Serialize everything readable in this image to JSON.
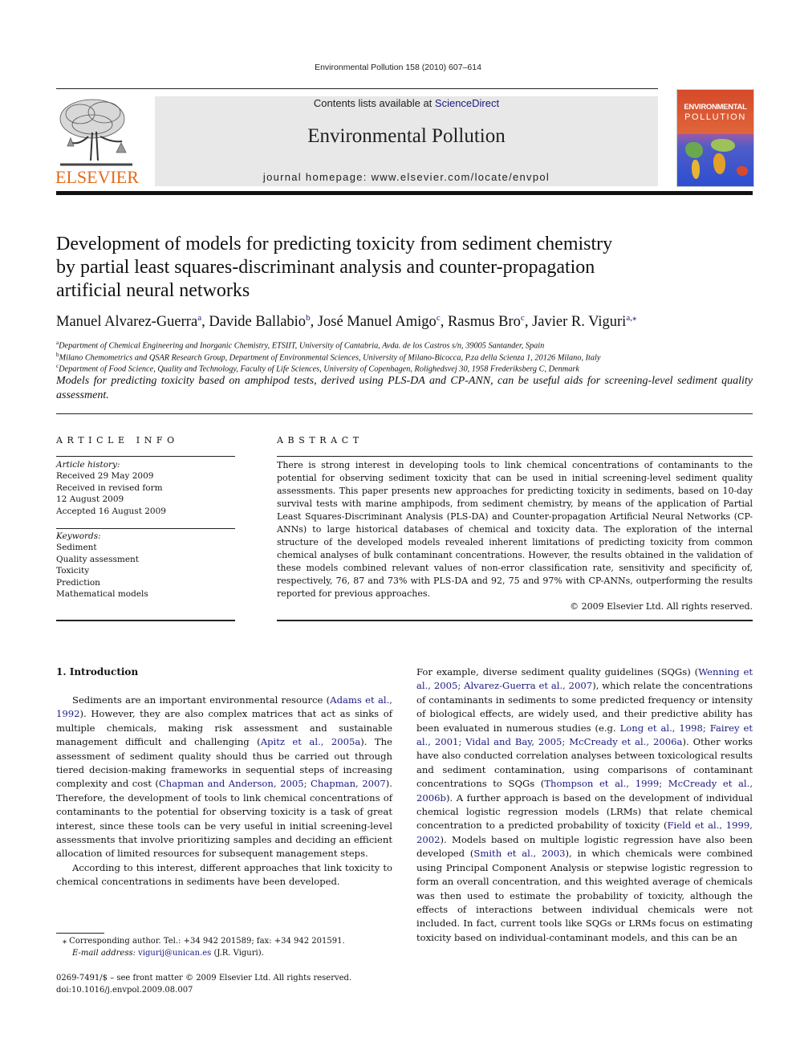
{
  "journal_citation": "Environmental Pollution 158 (2010) 607–614",
  "publisher": {
    "logo_text": "ELSEVIER",
    "logo_icon": "elsevier-tree-icon"
  },
  "banner": {
    "contents_prefix": "Contents lists available at ",
    "contents_link": "ScienceDirect",
    "journal_title": "Environmental Pollution",
    "homepage": "journal homepage: www.elsevier.com/locate/envpol"
  },
  "cover": {
    "line1": "ENVIRONMENTAL",
    "line2": "POLLUTION"
  },
  "article": {
    "title_lines": [
      "Development of models for predicting toxicity from sediment chemistry",
      "by partial least squares-discriminant analysis and counter-propagation",
      "artificial neural networks"
    ],
    "authors": [
      {
        "name": "Manuel Alvarez-Guerra",
        "aff": "a"
      },
      {
        "name": "Davide Ballabio",
        "aff": "b"
      },
      {
        "name": "José Manuel Amigo",
        "aff": "c"
      },
      {
        "name": "Rasmus Bro",
        "aff": "c"
      },
      {
        "name": "Javier R. Viguri",
        "aff": "a,⁎"
      }
    ],
    "affiliations": [
      {
        "key": "a",
        "text": "Department of Chemical Engineering and Inorganic Chemistry, ETSIIT, University of Cantabria, Avda. de los Castros s/n, 39005 Santander, Spain"
      },
      {
        "key": "b",
        "text": "Milano Chemometrics and QSAR Research Group, Department of Environmental Sciences, University of Milano-Bicocca, P.za della Scienza 1, 20126 Milano, Italy"
      },
      {
        "key": "c",
        "text": "Department of Food Science, Quality and Technology, Faculty of Life Sciences, University of Copenhagen, Rolighedsvej 30, 1958 Frederiksberg C, Denmark"
      }
    ],
    "highlight": "Models for predicting toxicity based on amphipod tests, derived using PLS-DA and CP-ANN, can be useful aids for screening-level sediment quality assessment."
  },
  "article_info": {
    "heading": "ARTICLE INFO",
    "history_label": "Article history:",
    "history": [
      "Received 29 May 2009",
      "Received in revised form",
      "12 August 2009",
      "Accepted 16 August 2009"
    ],
    "keywords_label": "Keywords:",
    "keywords": [
      "Sediment",
      "Quality assessment",
      "Toxicity",
      "Prediction",
      "Mathematical models"
    ]
  },
  "abstract": {
    "heading": "ABSTRACT",
    "text": "There is strong interest in developing tools to link chemical concentrations of contaminants to the potential for observing sediment toxicity that can be used in initial screening-level sediment quality assessments. This paper presents new approaches for predicting toxicity in sediments, based on 10-day survival tests with marine amphipods, from sediment chemistry, by means of the application of Partial Least Squares-Discriminant Analysis (PLS-DA) and Counter-propagation Artificial Neural Networks (CP-ANNs) to large historical databases of chemical and toxicity data. The exploration of the internal structure of the developed models revealed inherent limitations of predicting toxicity from common chemical analyses of bulk contaminant concentrations. However, the results obtained in the validation of these models combined relevant values of non-error classification rate, sensitivity and specificity of, respectively, 76, 87 and 73% with PLS-DA and 92, 75 and 97% with CP-ANNs, outperforming the results reported for previous approaches.",
    "copyright": "© 2009 Elsevier Ltd. All rights reserved."
  },
  "introduction": {
    "heading": "1.  Introduction",
    "left_p1": [
      {
        "t": "Sediments are an important environmental resource ("
      },
      {
        "t": "Adams et al., 1992",
        "link": true
      },
      {
        "t": "). However, they are also complex matrices that act as sinks of multiple chemicals, making risk assessment and sustainable management difficult and challenging ("
      },
      {
        "t": "Apitz et al., 2005a",
        "link": true
      },
      {
        "t": "). The assessment of sediment quality should thus be carried out through tiered decision-making frameworks in sequential steps of increasing complexity and cost ("
      },
      {
        "t": "Chapman and Anderson, 2005; Chapman, 2007",
        "link": true
      },
      {
        "t": "). Therefore, the development of tools to link chemical concentrations of contaminants to the potential for observing toxicity is a task of great interest, since these tools can be very useful in initial screening-level assessments that involve prioritizing samples and deciding an efficient allocation of limited resources for subsequent management steps."
      }
    ],
    "left_p2": "According to this interest, different approaches that link toxicity to chemical concentrations in sediments have been developed.",
    "right_p1": [
      {
        "t": "For example, diverse sediment quality guidelines (SQGs) ("
      },
      {
        "t": "Wenning et al., 2005; Alvarez-Guerra et al., 2007",
        "link": true
      },
      {
        "t": "), which relate the concentrations of contaminants in sediments to some predicted frequency or intensity of biological effects, are widely used, and their predictive ability has been evaluated in numerous studies (e.g. "
      },
      {
        "t": "Long et al., 1998; Fairey et al., 2001; Vidal and Bay, 2005; McCready et al., 2006a",
        "link": true
      },
      {
        "t": "). Other works have also conducted correlation analyses between toxicological results and sediment contamination, using comparisons of contaminant concentrations to SQGs ("
      },
      {
        "t": "Thompson et al., 1999; McCready et al., 2006b",
        "link": true
      },
      {
        "t": "). A further approach is based on the development of individual chemical logistic regression models (LRMs) that relate chemical concentration to a predicted probability of toxicity ("
      },
      {
        "t": "Field et al., 1999, 2002",
        "link": true
      },
      {
        "t": "). Models based on multiple logistic regression have also been developed ("
      },
      {
        "t": "Smith et al., 2003",
        "link": true
      },
      {
        "t": "), in which chemicals were combined using Principal Component Analysis or stepwise logistic regression to form an overall concentration, and this weighted average of chemicals was then used to estimate the probability of toxicity, although the effects of interactions between individual chemicals were not included. In fact, current tools like SQGs or LRMs focus on estimating toxicity based on individual-contaminant models, and this can be an"
      }
    ]
  },
  "footnotes": {
    "corresponding": "⁎  Corresponding author. Tel.: +34 942 201589; fax: +34 942 201591.",
    "email_label": "E-mail address: ",
    "email": "vigurij@unican.es",
    "email_suffix": " (J.R. Viguri).",
    "front_matter": "0269-7491/$ – see front matter © 2009 Elsevier Ltd. All rights reserved.",
    "doi": "doi:10.1016/j.envpol.2009.08.007"
  }
}
